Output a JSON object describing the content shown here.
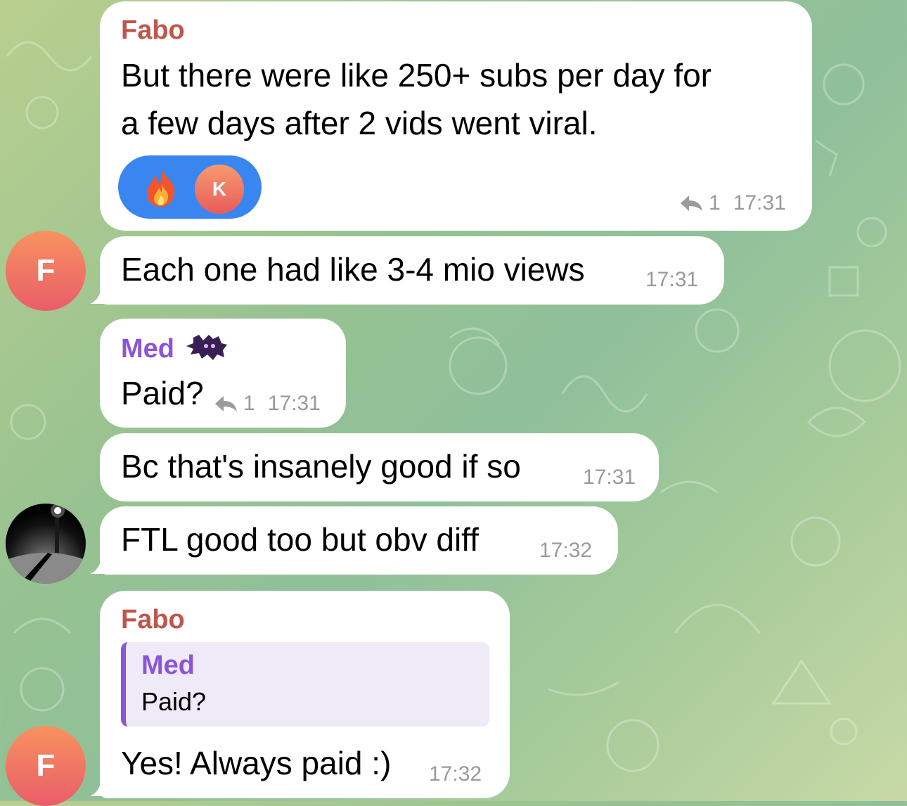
{
  "chat": {
    "messages": [
      {
        "sender": "Fabo",
        "text_line1": "But there were like 250+ subs per day for",
        "text_line2": "a few days after 2 vids went viral.",
        "reaction_avatar": "K",
        "reply_count": "1",
        "time": "17:31",
        "reaction_icon": "fire-icon"
      },
      {
        "text": "Each one had like 3-4 mio views",
        "time": "17:31",
        "avatar_initial": "F"
      },
      {
        "sender": "Med",
        "text": "Paid?",
        "reply_count": "1",
        "time": "17:31"
      },
      {
        "text": "Bc that's insanely good if so",
        "time": "17:31"
      },
      {
        "text": "FTL good too but obv diff",
        "time": "17:32"
      },
      {
        "sender": "Fabo",
        "quote_sender": "Med",
        "quote_text": "Paid?",
        "text": "Yes! Always paid :)",
        "time": "17:32",
        "avatar_initial": "F"
      }
    ]
  },
  "colors": {
    "fabo_name": "#c0564b",
    "med_name": "#8a55d8",
    "reaction_bg": "#3a86f0",
    "meta": "#9a9a9a"
  }
}
